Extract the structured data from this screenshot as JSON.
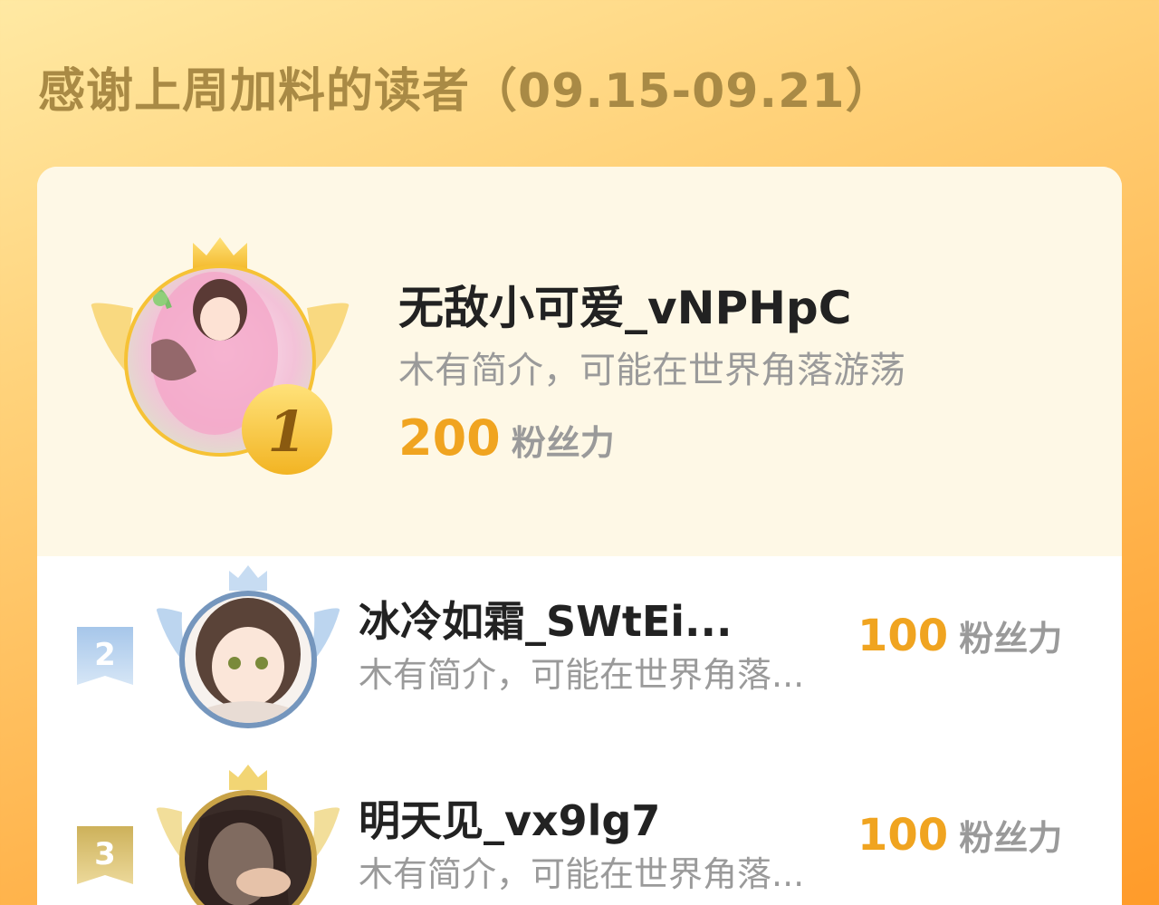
{
  "header": {
    "title": "感谢上周加料的读者（09.15-09.21）"
  },
  "readers": [
    {
      "rank": "1",
      "name": "无敌小可爱_vNPHpC",
      "bio": "木有简介，可能在世界角落游荡",
      "score": "200",
      "unit": "粉丝力"
    },
    {
      "rank": "2",
      "name": "冰冷如霜_SWtEi...",
      "bio": "木有简介，可能在世界角落...",
      "score": "100",
      "unit": "粉丝力"
    },
    {
      "rank": "3",
      "name": "明天见_vx9lg7",
      "bio": "木有简介，可能在世界角落...",
      "score": "100",
      "unit": "粉丝力"
    }
  ],
  "colors": {
    "gold": "#f6c235",
    "silver": "#8fb4df",
    "bronze": "#d9bb63",
    "score": "#f0a420",
    "title": "#a98a45"
  },
  "icons": {
    "crown": "crown-icon",
    "wings": "wings-icon",
    "rank_badge": "rank-badge-icon"
  }
}
